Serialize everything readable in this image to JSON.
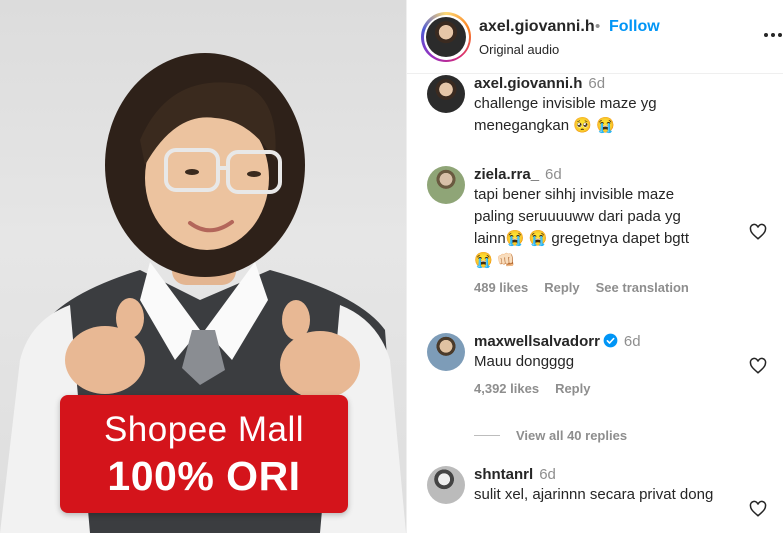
{
  "post": {
    "promo_line1": "Shopee Mall",
    "promo_line2": "100% ORI"
  },
  "header": {
    "username": "axel.giovanni.h",
    "separator": "•",
    "follow_label": "Follow",
    "audio_label": "Original audio",
    "more_icon": "more-horizontal-icon"
  },
  "comments": [
    {
      "username": "axel.giovanni.h",
      "time": "6d",
      "text": "challenge invisible maze yg menegangkan 🥺 😭",
      "likes": "",
      "reply_label": "",
      "translation_label": ""
    },
    {
      "username": "ziela.rra_",
      "time": "6d",
      "text": "tapi bener sihhj invisible maze paling seruuuuww dari pada yg lainn😭 😭 gregetnya dapet bgtt 😭 👊🏻",
      "likes": "489 likes",
      "reply_label": "Reply",
      "translation_label": "See translation"
    },
    {
      "username": "maxwellsalvadorr",
      "verified": true,
      "time": "6d",
      "text": "Mauu dongggg",
      "likes": "4,392 likes",
      "reply_label": "Reply",
      "view_replies_label": "View all 40 replies"
    },
    {
      "username": "shntanrl",
      "time": "6d",
      "text": "sulit xel, ajarinnn secara privat dong"
    }
  ],
  "colors": {
    "accent": "#0095f6",
    "muted": "#8e8e8e",
    "text": "#262626",
    "promo_red": "#d4141b"
  }
}
